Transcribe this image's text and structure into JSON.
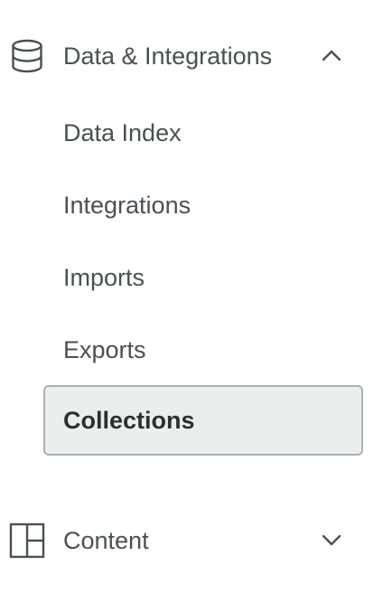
{
  "nav": {
    "sections": [
      {
        "label": "Data & Integrations",
        "icon": "database-icon",
        "expanded": true,
        "items": [
          {
            "label": "Data Index"
          },
          {
            "label": "Integrations"
          },
          {
            "label": "Imports"
          },
          {
            "label": "Exports"
          },
          {
            "label": "Collections",
            "active": true
          }
        ]
      },
      {
        "label": "Content",
        "icon": "layout-icon",
        "expanded": false
      }
    ]
  },
  "colors": {
    "text": "#48524f",
    "active_text": "#2a3230",
    "active_bg": "#ebeeee",
    "active_border": "#a9b2b0"
  }
}
